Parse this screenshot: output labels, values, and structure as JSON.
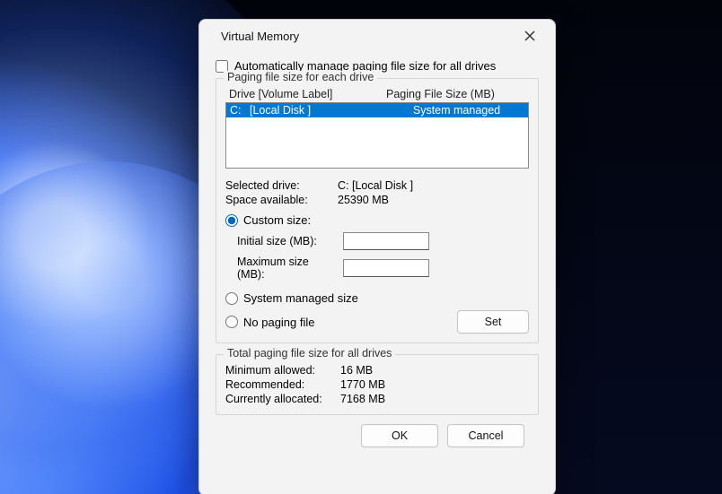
{
  "window": {
    "title": "Virtual Memory"
  },
  "auto_manage": {
    "label": "Automatically manage paging file size for all drives",
    "checked": false
  },
  "drives_group": {
    "label": "Paging file size for each drive",
    "headers": {
      "drive": "Drive  [Volume Label]",
      "size": "Paging File Size (MB)"
    },
    "rows": [
      {
        "letter": "C:",
        "volume": "[Local Disk ]",
        "size": "System managed",
        "selected": true
      }
    ],
    "selected_drive": {
      "label": "Selected drive:",
      "value": "C:  [Local Disk ]"
    },
    "space_available": {
      "label": "Space available:",
      "value": "25390 MB"
    },
    "options": {
      "custom": {
        "label": "Custom size:",
        "selected": true,
        "initial": {
          "label": "Initial size (MB):",
          "value": ""
        },
        "maximum": {
          "label": "Maximum size (MB):",
          "value": ""
        }
      },
      "system": {
        "label": "System managed size",
        "selected": false
      },
      "none": {
        "label": "No paging file",
        "selected": false
      }
    },
    "set_button": "Set"
  },
  "totals_group": {
    "label": "Total paging file size for all drives",
    "minimum": {
      "label": "Minimum allowed:",
      "value": "16 MB"
    },
    "recommended": {
      "label": "Recommended:",
      "value": "1770 MB"
    },
    "current": {
      "label": "Currently allocated:",
      "value": "7168 MB"
    }
  },
  "buttons": {
    "ok": "OK",
    "cancel": "Cancel"
  }
}
